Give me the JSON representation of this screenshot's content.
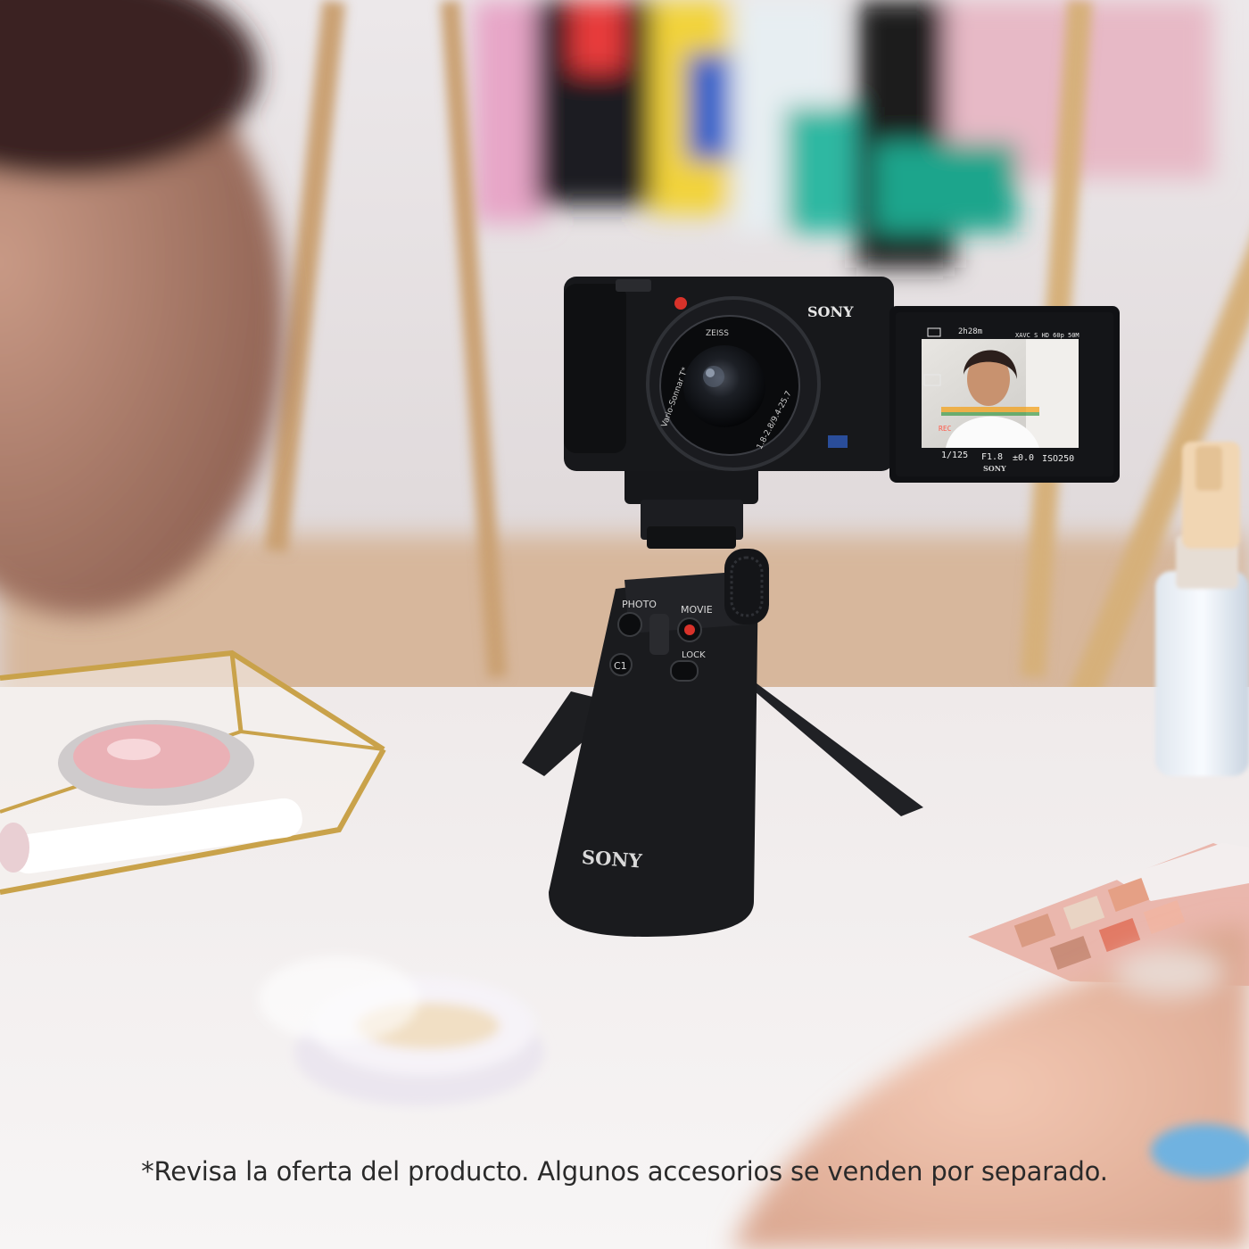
{
  "camera": {
    "brand": "SONY",
    "lens_brand": "ZEISS",
    "lens_text": "Vario-Sonnar T*",
    "lens_spec": "1.8-2.8/9.4-25.7",
    "screen": {
      "brand": "SONY",
      "shutter": "1/125",
      "aperture": "F1.8",
      "exposure": "±0.0",
      "iso": "ISO250",
      "rec_label": "REC",
      "time": "2h28m",
      "format": "XAVC S HD 60p 50M"
    }
  },
  "grip": {
    "brand": "SONY",
    "photo_label": "PHOTO",
    "movie_label": "MOVIE",
    "c1_label": "C1",
    "lock_label": "LOCK"
  },
  "disclaimer": "*Revisa la oferta del producto. Algunos accesorios se venden por separado.",
  "colors": {
    "wall": "#e8e3e6",
    "table": "#f4f1f2",
    "gold": "#c9a24a",
    "camera_body": "#17181b",
    "record_red": "#d8322a"
  }
}
